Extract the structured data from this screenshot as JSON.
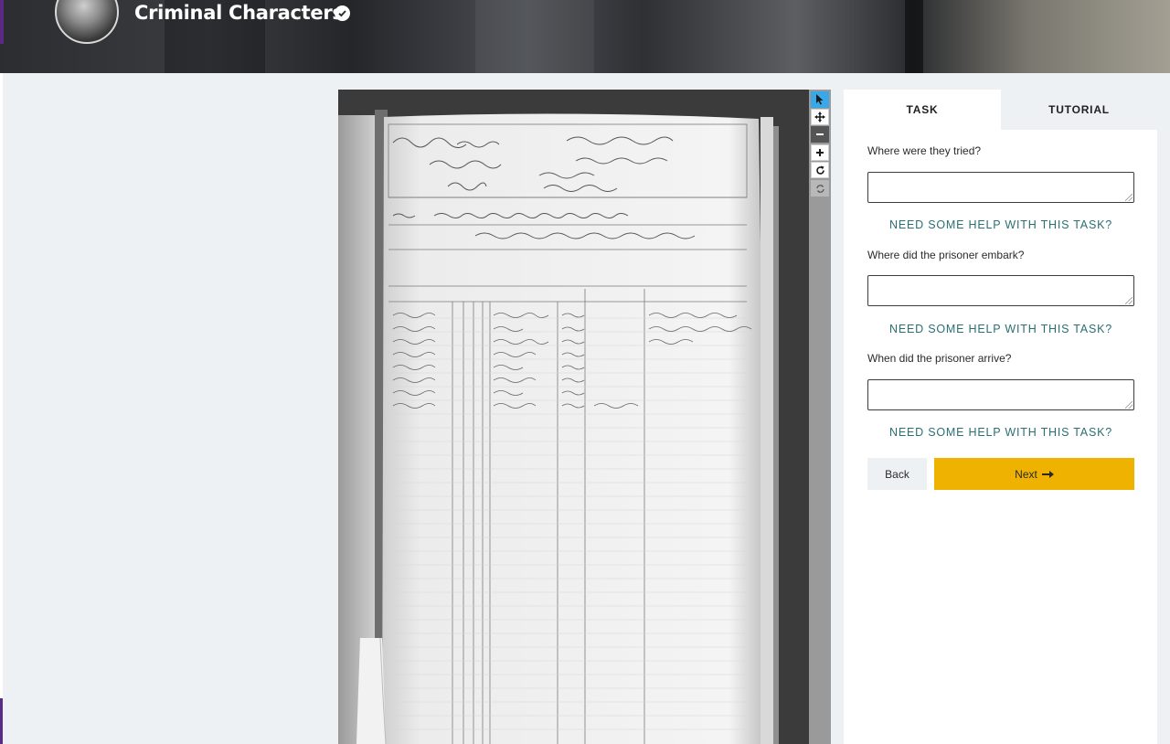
{
  "header": {
    "project_title": "Criminal Characters",
    "verified_icon": "check-circle-icon",
    "avatar_icon": "project-avatar"
  },
  "viewer": {
    "tools": [
      {
        "name": "pointer",
        "icon": "pointer-icon"
      },
      {
        "name": "pan",
        "icon": "move-icon"
      },
      {
        "name": "zoom-out",
        "icon": "minus-icon"
      },
      {
        "name": "zoom-in",
        "icon": "plus-icon"
      },
      {
        "name": "rotate",
        "icon": "rotate-icon"
      },
      {
        "name": "reset",
        "icon": "refresh-icon"
      }
    ]
  },
  "panel": {
    "tabs": [
      {
        "label": "TASK",
        "active": true
      },
      {
        "label": "TUTORIAL",
        "active": false
      }
    ],
    "questions": [
      {
        "label": "Where were they tried?",
        "value": "",
        "help": "NEED SOME HELP WITH THIS TASK?"
      },
      {
        "label": "Where did the prisoner embark?",
        "value": "",
        "help": "NEED SOME HELP WITH THIS TASK?"
      },
      {
        "label": "When did the prisoner arrive?",
        "value": "",
        "help": "NEED SOME HELP WITH THIS TASK?"
      }
    ],
    "back_label": "Back",
    "next_label": "Next",
    "next_icon": "arrow-right-icon"
  },
  "colors": {
    "accent_yellow": "#f0b200",
    "help_teal": "#2a6f73",
    "brand_purple": "#5b2a86",
    "active_tool": "#3aa8e6"
  }
}
